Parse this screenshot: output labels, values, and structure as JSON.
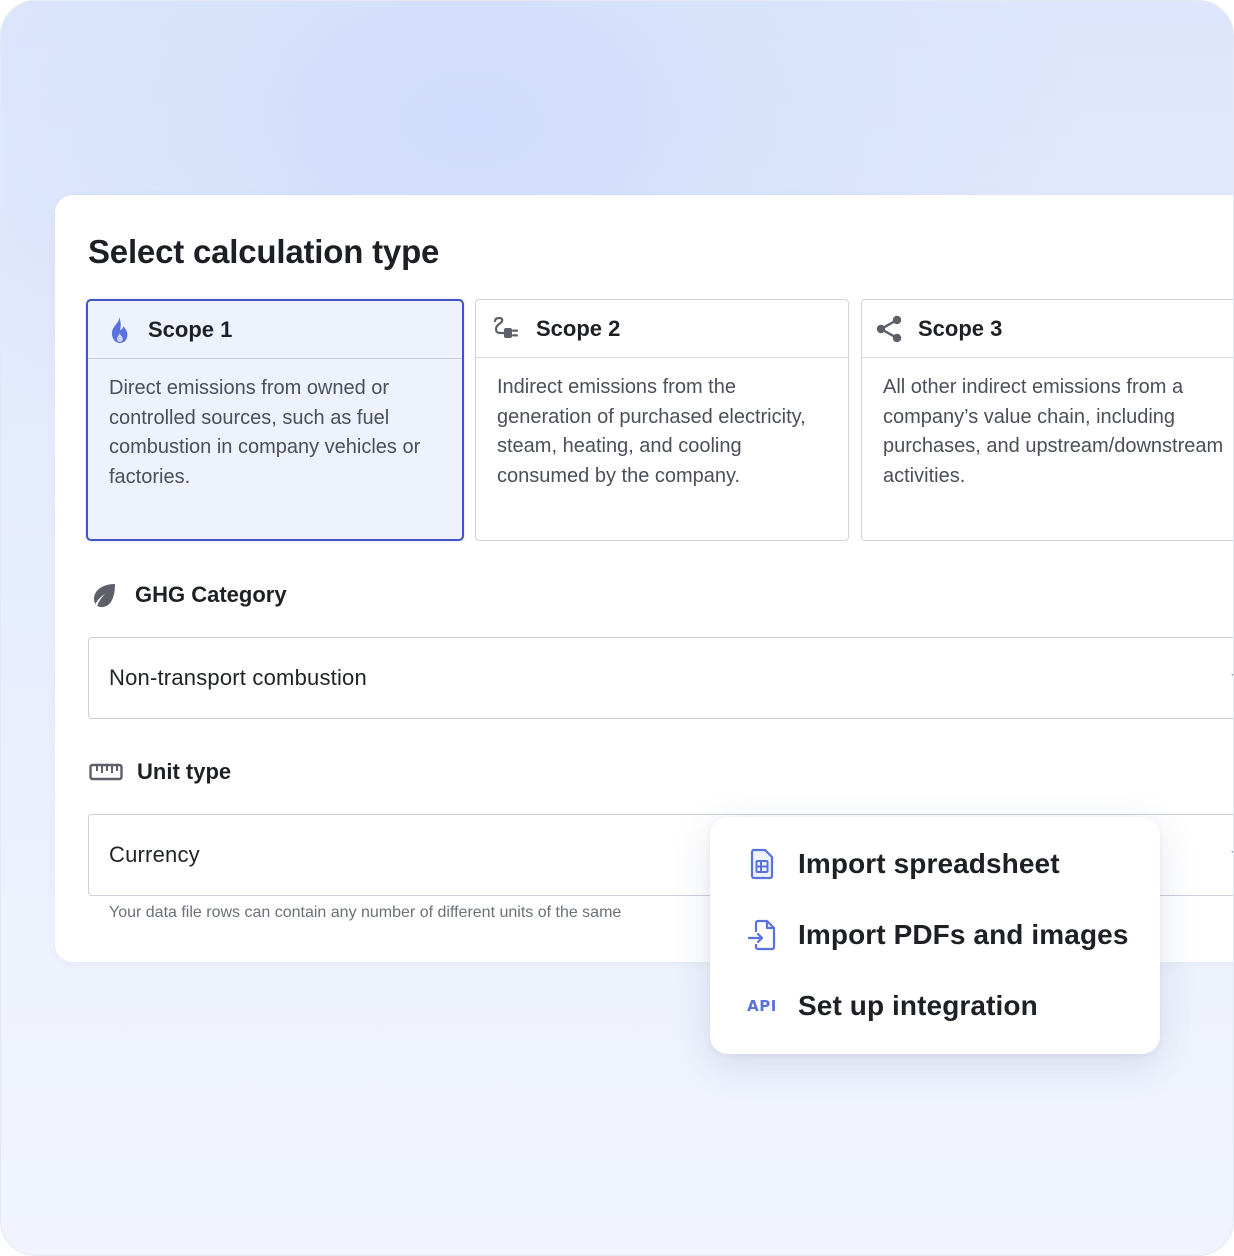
{
  "title": "Select calculation type",
  "scopes": [
    {
      "title": "Scope 1",
      "icon": "flame-icon",
      "description": "Direct emissions from owned or controlled sources, such as fuel combustion in company vehicles or factories.",
      "selected": true
    },
    {
      "title": "Scope 2",
      "icon": "plug-icon",
      "description": "Indirect emissions from the generation of purchased electricity, steam, heating, and cooling consumed by the company.",
      "selected": false
    },
    {
      "title": "Scope 3",
      "icon": "share-icon",
      "description": "All other indirect emissions from a company’s value chain, including purchases, and upstream/downstream activities.",
      "selected": false
    }
  ],
  "ghg_category": {
    "label": "GHG Category",
    "icon": "leaf-icon",
    "value": "Non-transport combustion"
  },
  "unit_type": {
    "label": "Unit type",
    "icon": "ruler-icon",
    "value": "Currency",
    "helper": "Your data file rows can contain any number of different units of the same"
  },
  "import_menu": {
    "items": [
      {
        "label": "Import spreadsheet",
        "icon": "spreadsheet-icon"
      },
      {
        "label": "Import PDFs and images",
        "icon": "file-import-icon"
      },
      {
        "label": "Set up integration",
        "icon": "api-icon",
        "icon_text": "API"
      }
    ]
  },
  "colors": {
    "accent": "#3f55c8",
    "icon_blue": "#5a72e0",
    "selected_bg": "#eef2fd"
  }
}
